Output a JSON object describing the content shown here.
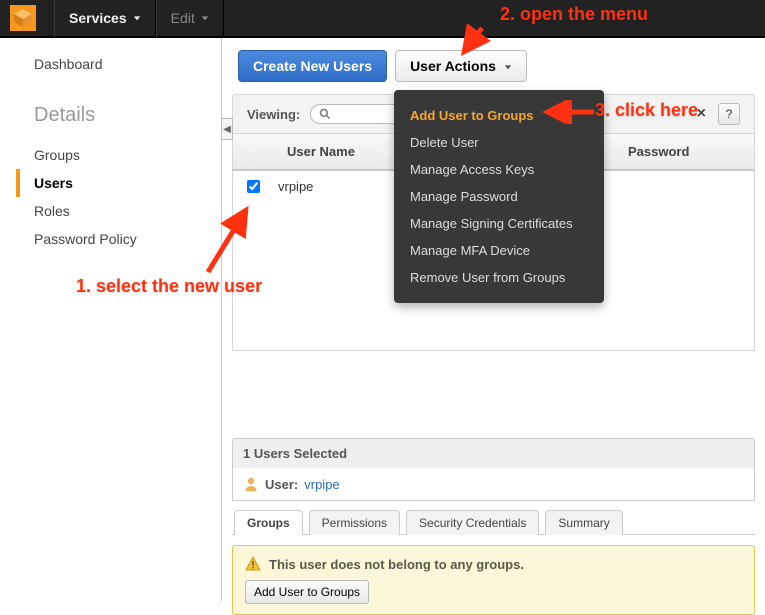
{
  "nav": {
    "services": "Services",
    "edit": "Edit"
  },
  "sidebar": {
    "dashboard": "Dashboard",
    "details_heading": "Details",
    "items": [
      "Groups",
      "Users",
      "Roles",
      "Password Policy"
    ],
    "active_index": 1
  },
  "toolbar": {
    "create_label": "Create New Users",
    "actions_label": "User Actions"
  },
  "viewing": {
    "label": "Viewing:",
    "search_value": ""
  },
  "table": {
    "col_user": "User Name",
    "col_password": "Password",
    "rows": [
      {
        "checked": true,
        "name": "vrpipe"
      }
    ]
  },
  "menu": {
    "items": [
      "Add User to Groups",
      "Delete User",
      "Manage Access Keys",
      "Manage Password",
      "Manage Signing Certificates",
      "Manage MFA Device",
      "Remove User from Groups"
    ],
    "highlight_index": 0
  },
  "detail": {
    "selected_text": "1 Users Selected",
    "user_label": "User:",
    "user_name": "vrpipe",
    "tabs": [
      "Groups",
      "Permissions",
      "Security Credentials",
      "Summary"
    ],
    "active_tab": 0,
    "notice_text": "This user does not belong to any groups.",
    "notice_button": "Add User to Groups"
  },
  "annotations": {
    "step1": "1. select the new user",
    "step2": "2. open the menu",
    "step3": "3. click here"
  }
}
